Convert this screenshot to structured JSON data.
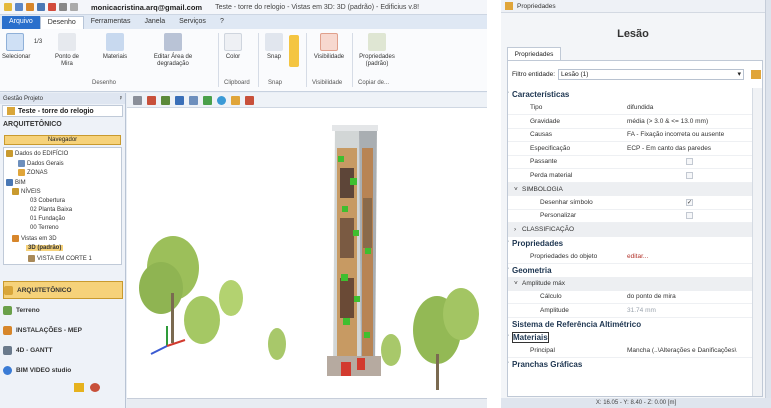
{
  "app": {
    "account_email": "monicacristina.arq@gmail.com",
    "document_title": "Teste - torre do relogio - Vistas em 3D: 3D (padrão) - Edificius v.8!"
  },
  "menu": {
    "tabs": [
      "Arquivo",
      "Desenho",
      "Ferramentas",
      "Janela",
      "Serviços",
      "?"
    ]
  },
  "ribbon": {
    "buttons": {
      "select": "Selecionar",
      "target_point": "Ponto de Mira",
      "materials": "Materiais",
      "edit_degradation": "Editar Área de degradação",
      "color": "Color",
      "snap": "Snap",
      "visibility": "Visibilidade",
      "properties_default": "Propriedades (padrão)",
      "copy": "Copiar de..."
    },
    "groups": {
      "desenho": "Desenho",
      "clipboard": "Clipboard",
      "snap": "Snap",
      "visibilidade": "Visibilidade"
    },
    "scale_value": "1/3"
  },
  "left_panel": {
    "header": "Gestão Projeto",
    "project_name": "Teste - torre do relogio",
    "section": "ARQUITETÔNICO",
    "navigator": "Navegador",
    "tree": [
      "Dados do EDIFÍCIO",
      "Dados Gerais",
      "ZONAS",
      "BIM",
      "NÍVEIS",
      "03 Cobertura",
      "02 Planta Baixa",
      "01 Fundação",
      "00 Terreno",
      "Vistas em 3D",
      "3D (padrão)",
      "VISTA EM CORTE 1"
    ],
    "modules": [
      "ARQUITETÔNICO",
      "Terreno",
      "INSTALAÇÕES - MEP",
      "4D - GANTT",
      "BIM VIDEO studio"
    ]
  },
  "properties": {
    "panel_title": "Propriedades",
    "element_title": "Lesão",
    "tab": "Propriedades",
    "filter_label": "Filtro entidade:",
    "filter_value": "Lesão (1)",
    "rows": [
      {
        "type": "cat",
        "key": "Características"
      },
      {
        "type": "prop",
        "key": "Tipo",
        "value": "difundida"
      },
      {
        "type": "prop",
        "key": "Gravidade",
        "value": "média (> 3.0 & <= 13.0 mm)"
      },
      {
        "type": "prop",
        "key": "Causas",
        "value": "FA - Fixação incorreta ou ausente"
      },
      {
        "type": "prop",
        "key": "Especificação",
        "value": "ECP - Em canto das paredes"
      },
      {
        "type": "prop",
        "key": "Passante",
        "value": ""
      },
      {
        "type": "prop",
        "key": "Perda material",
        "value": ""
      },
      {
        "type": "sub",
        "key": "SIMBOLOGIA"
      },
      {
        "type": "prop2",
        "key": "Desenhar símbolo",
        "value": ""
      },
      {
        "type": "prop2",
        "key": "Personalizar",
        "value": ""
      },
      {
        "type": "sub",
        "key": "CLASSIFICAÇÃO"
      },
      {
        "type": "cat",
        "key": "Propriedades"
      },
      {
        "type": "prop",
        "key": "Propriedades do objeto",
        "value": "editar..."
      },
      {
        "type": "cat",
        "key": "Geometria"
      },
      {
        "type": "sub",
        "key": "Amplitude máx"
      },
      {
        "type": "prop2",
        "key": "Cálculo",
        "value": "do ponto de mira"
      },
      {
        "type": "prop2",
        "key": "Amplitude",
        "value": "31.74 mm"
      },
      {
        "type": "cat",
        "key": "Sistema de Referência Altimétrico"
      },
      {
        "type": "cat",
        "key": "Materiais"
      },
      {
        "type": "prop",
        "key": "Principal",
        "value": "Mancha   (..\\Alterações e Danificações\\"
      },
      {
        "type": "cat",
        "key": "Pranchas Gráficas"
      }
    ],
    "checkboxes": {
      "passante": false,
      "perda_material": false,
      "desenhar_simbolo": true,
      "personalizar": false
    }
  },
  "status": {
    "coords": "X: 16.05 - Y: 8.40 - Z: 0.00 [m]"
  },
  "colors": {
    "accent": "#2a6fcc",
    "highlight": "#f6d27a",
    "category_text": "#1d3550",
    "edit_link": "#b2332b"
  }
}
